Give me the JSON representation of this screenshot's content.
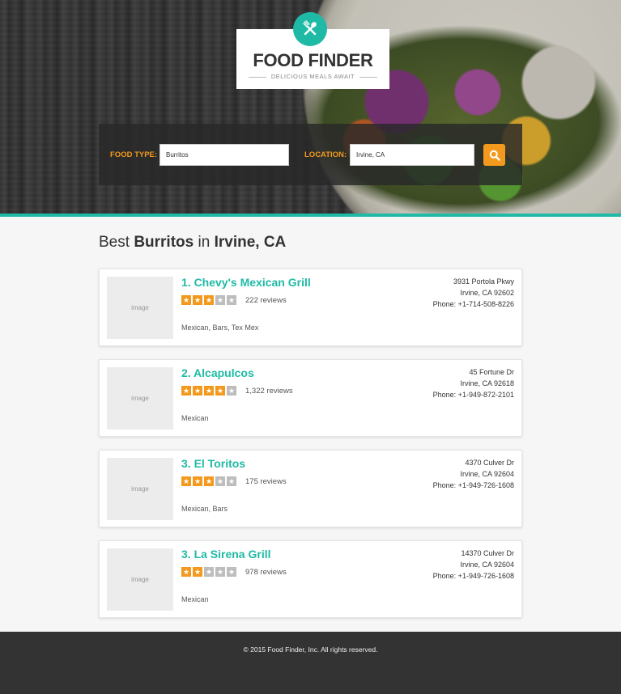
{
  "brand": {
    "title": "FOOD FINDER",
    "subtitle": "DELICIOUS MEALS AWAIT",
    "logo_icon": "fork-spoon-icon",
    "accent_color": "#1fbaa6"
  },
  "search": {
    "food_type_label": "FOOD TYPE:",
    "food_type_value": "Burritos",
    "location_label": "LOCATION:",
    "location_value": "Irvine, CA",
    "button_icon": "search-icon",
    "button_color": "#f39a1e"
  },
  "results": {
    "heading_prefix": "Best",
    "heading_food": "Burritos",
    "heading_mid": "in",
    "heading_location": "Irvine, CA",
    "image_placeholder": "image",
    "items": [
      {
        "name": "1. Chevy's Mexican Grill",
        "rating": 3,
        "max_rating": 5,
        "reviews": "222 reviews",
        "categories": "Mexican, Bars, Tex Mex",
        "address_line1": "3931 Portola Pkwy",
        "address_line2": "Irvine, CA 92602",
        "phone": "Phone: +1-714-508-8226"
      },
      {
        "name": "2. Alcapulcos",
        "rating": 4,
        "max_rating": 5,
        "reviews": "1,322 reviews",
        "categories": "Mexican",
        "address_line1": "45 Fortune Dr",
        "address_line2": "Irvine, CA 92618",
        "phone": "Phone: +1-949-872-2101"
      },
      {
        "name": "3. El Toritos",
        "rating": 3,
        "max_rating": 5,
        "reviews": "175 reviews",
        "categories": "Mexican, Bars",
        "address_line1": "4370 Culver Dr",
        "address_line2": "Irvine, CA 92604",
        "phone": "Phone: +1-949-726-1608"
      },
      {
        "name": "3. La Sirena Grill",
        "rating": 2,
        "max_rating": 5,
        "reviews": "978 reviews",
        "categories": "Mexican",
        "address_line1": "14370 Culver Dr",
        "address_line2": "Irvine, CA 92604",
        "phone": "Phone: +1-949-726-1608"
      }
    ]
  },
  "footer": {
    "copyright": "© 2015 Food Finder, Inc.   All rights reserved."
  }
}
